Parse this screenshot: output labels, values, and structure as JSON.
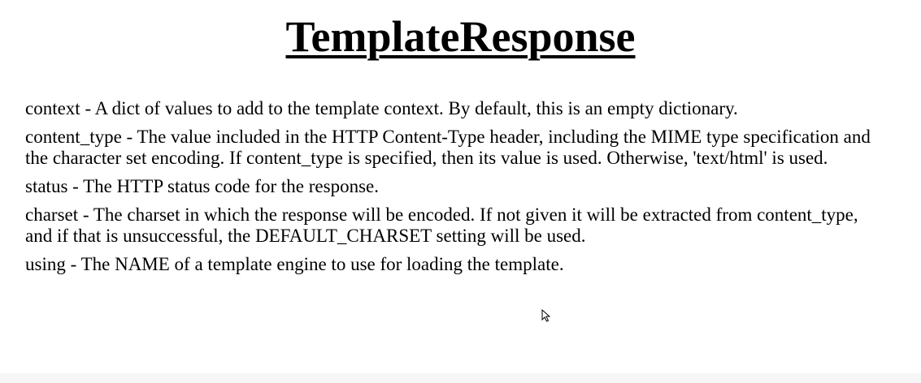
{
  "title": "TemplateResponse",
  "params": [
    {
      "text": "context - A dict of values to add to the template context. By default, this is an empty dictionary."
    },
    {
      "text": "content_type - The value included in the HTTP Content-Type header, including the MIME type specification and the character set encoding. If content_type is specified, then its value is used. Otherwise, 'text/html' is used."
    },
    {
      "text": "status - The HTTP status code for the response."
    },
    {
      "text": "charset - The charset in which the response will be encoded. If not given it will be extracted from content_type, and if that is unsuccessful, the DEFAULT_CHARSET setting will be used."
    },
    {
      "text": "using - The NAME of a template engine to use for loading the template."
    }
  ],
  "cursor": {
    "icon": "arrow-cursor-icon"
  }
}
